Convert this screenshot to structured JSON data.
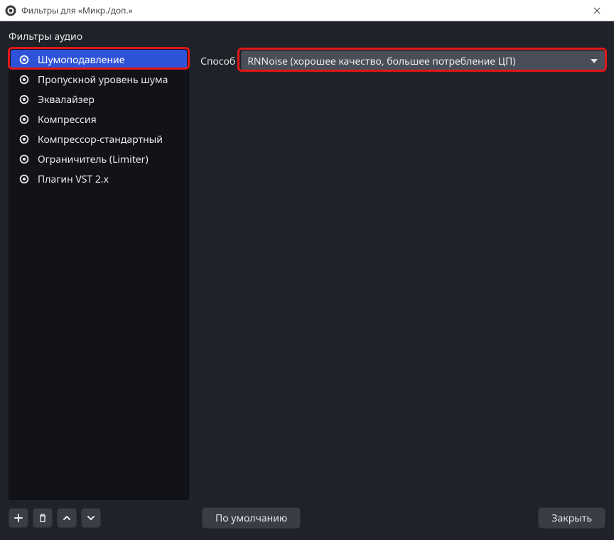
{
  "window": {
    "title": "Фильтры для «Микр./доп.»"
  },
  "section_title": "Фильтры аудиo",
  "filters": [
    {
      "label": "Шумоподавление",
      "selected": true
    },
    {
      "label": "Пропускной уровень шума",
      "selected": false
    },
    {
      "label": "Эквалайзер",
      "selected": false
    },
    {
      "label": "Компрессия",
      "selected": false
    },
    {
      "label": "Компрессор-стандартный",
      "selected": false
    },
    {
      "label": "Ограничитель (Limiter)",
      "selected": false
    },
    {
      "label": "Плагин VST 2.x",
      "selected": false
    }
  ],
  "settings": {
    "method_label": "Способ",
    "method_value": "RNNoise (хорошее качество, большее потребление ЦП)"
  },
  "buttons": {
    "defaults": "По умолчанию",
    "close": "Закрыть"
  },
  "highlights": {
    "filter_item_red": true,
    "dropdown_red": true
  }
}
